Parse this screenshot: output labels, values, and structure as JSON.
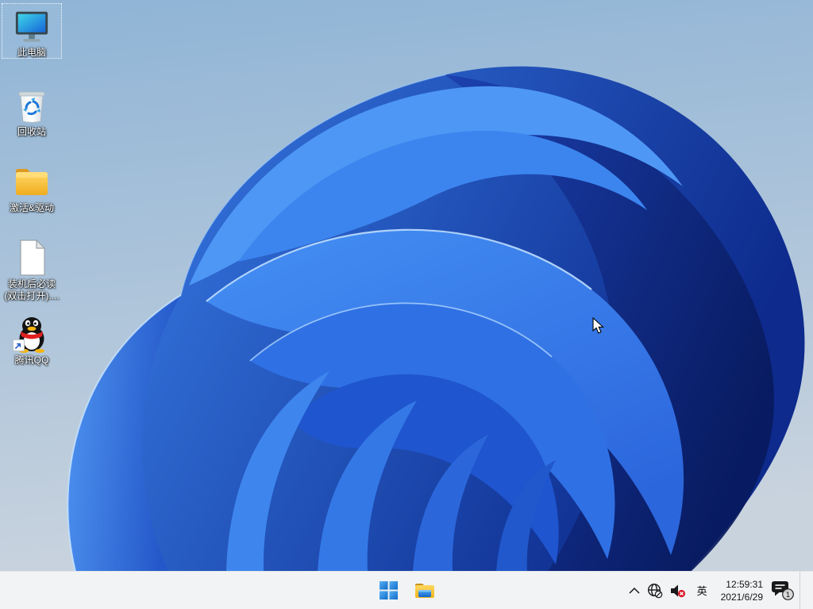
{
  "desktop": {
    "icons": [
      {
        "label": "此电脑",
        "icon": "monitor-icon",
        "selected": true
      },
      {
        "label": "回收站",
        "icon": "recycle-bin-icon",
        "selected": false
      },
      {
        "label": "激活&驱动",
        "icon": "folder-icon",
        "selected": false
      },
      {
        "label": "装机后必读(双击打开)....",
        "icon": "document-icon",
        "selected": false
      },
      {
        "label": "腾讯QQ",
        "icon": "qq-icon",
        "selected": false
      }
    ]
  },
  "taskbar": {
    "tray": {
      "input_method": "英",
      "time": "12:59:31",
      "date": "2021/6/29",
      "notification_badge": "1"
    }
  },
  "colors": {
    "background_top": "#8fb4d6",
    "background_bottom": "#c9d3de",
    "bloom_bright": "#3f8bf4",
    "bloom_dark": "#0a1e66",
    "taskbar_bg": "#f1f3f5",
    "start_blue": "#1273d4",
    "folder_yellow": "#f6bd2b",
    "mute_badge_red": "#d81a2b",
    "tray_icon": "#1a1a1a"
  }
}
